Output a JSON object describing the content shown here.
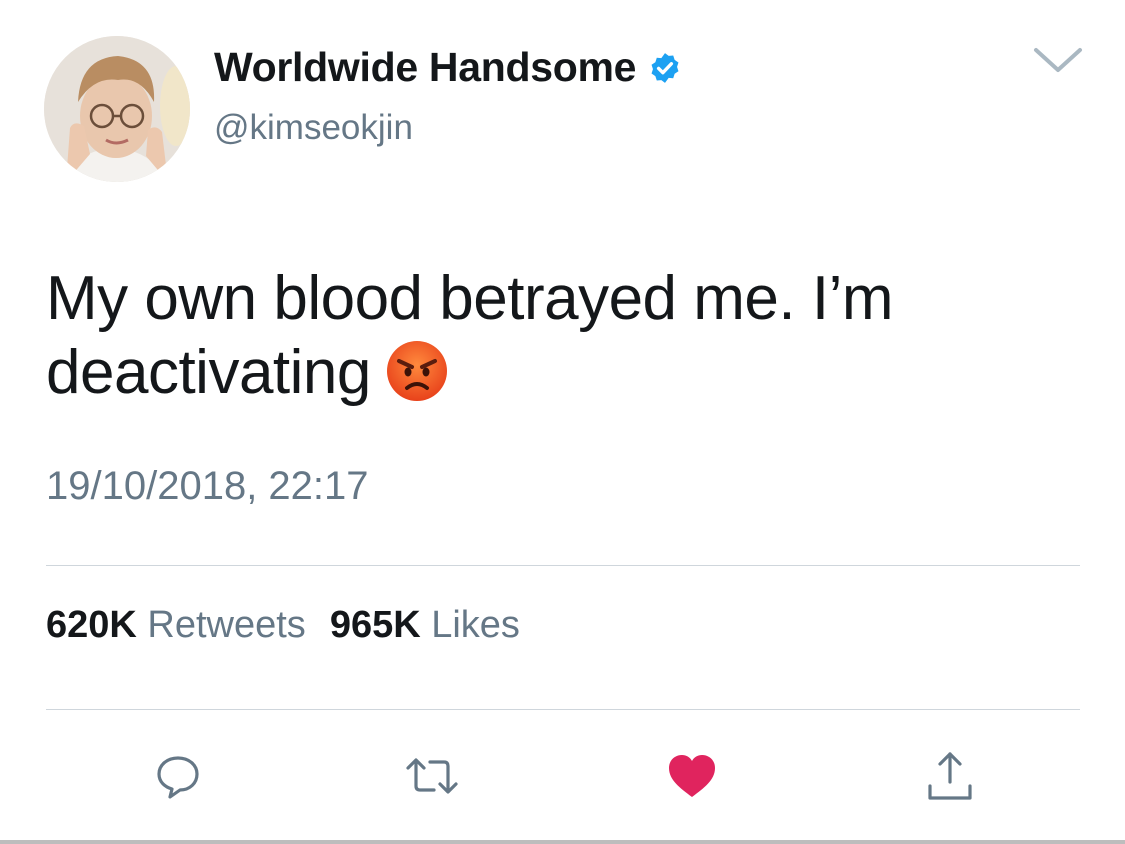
{
  "tweet": {
    "display_name": "Worldwide Handsome",
    "handle": "@kimseokjin",
    "verified": true,
    "text": "My own blood betrayed me. I’m deactivating",
    "emoji": "angry-face",
    "timestamp": "19/10/2018, 22:17",
    "stats": {
      "retweets_count": "620K",
      "retweets_label": "Retweets",
      "likes_count": "965K",
      "likes_label": "Likes"
    },
    "liked": true
  },
  "icons": {
    "reply": "speech-bubble-icon",
    "retweet": "retweet-arrows-icon",
    "like": "heart-icon",
    "share": "share-upload-icon",
    "menu": "chevron-down-icon"
  },
  "colors": {
    "verified_blue": "#1da1f2",
    "like_red": "#e0245e",
    "secondary_text": "#657786",
    "primary_text": "#14171a"
  }
}
